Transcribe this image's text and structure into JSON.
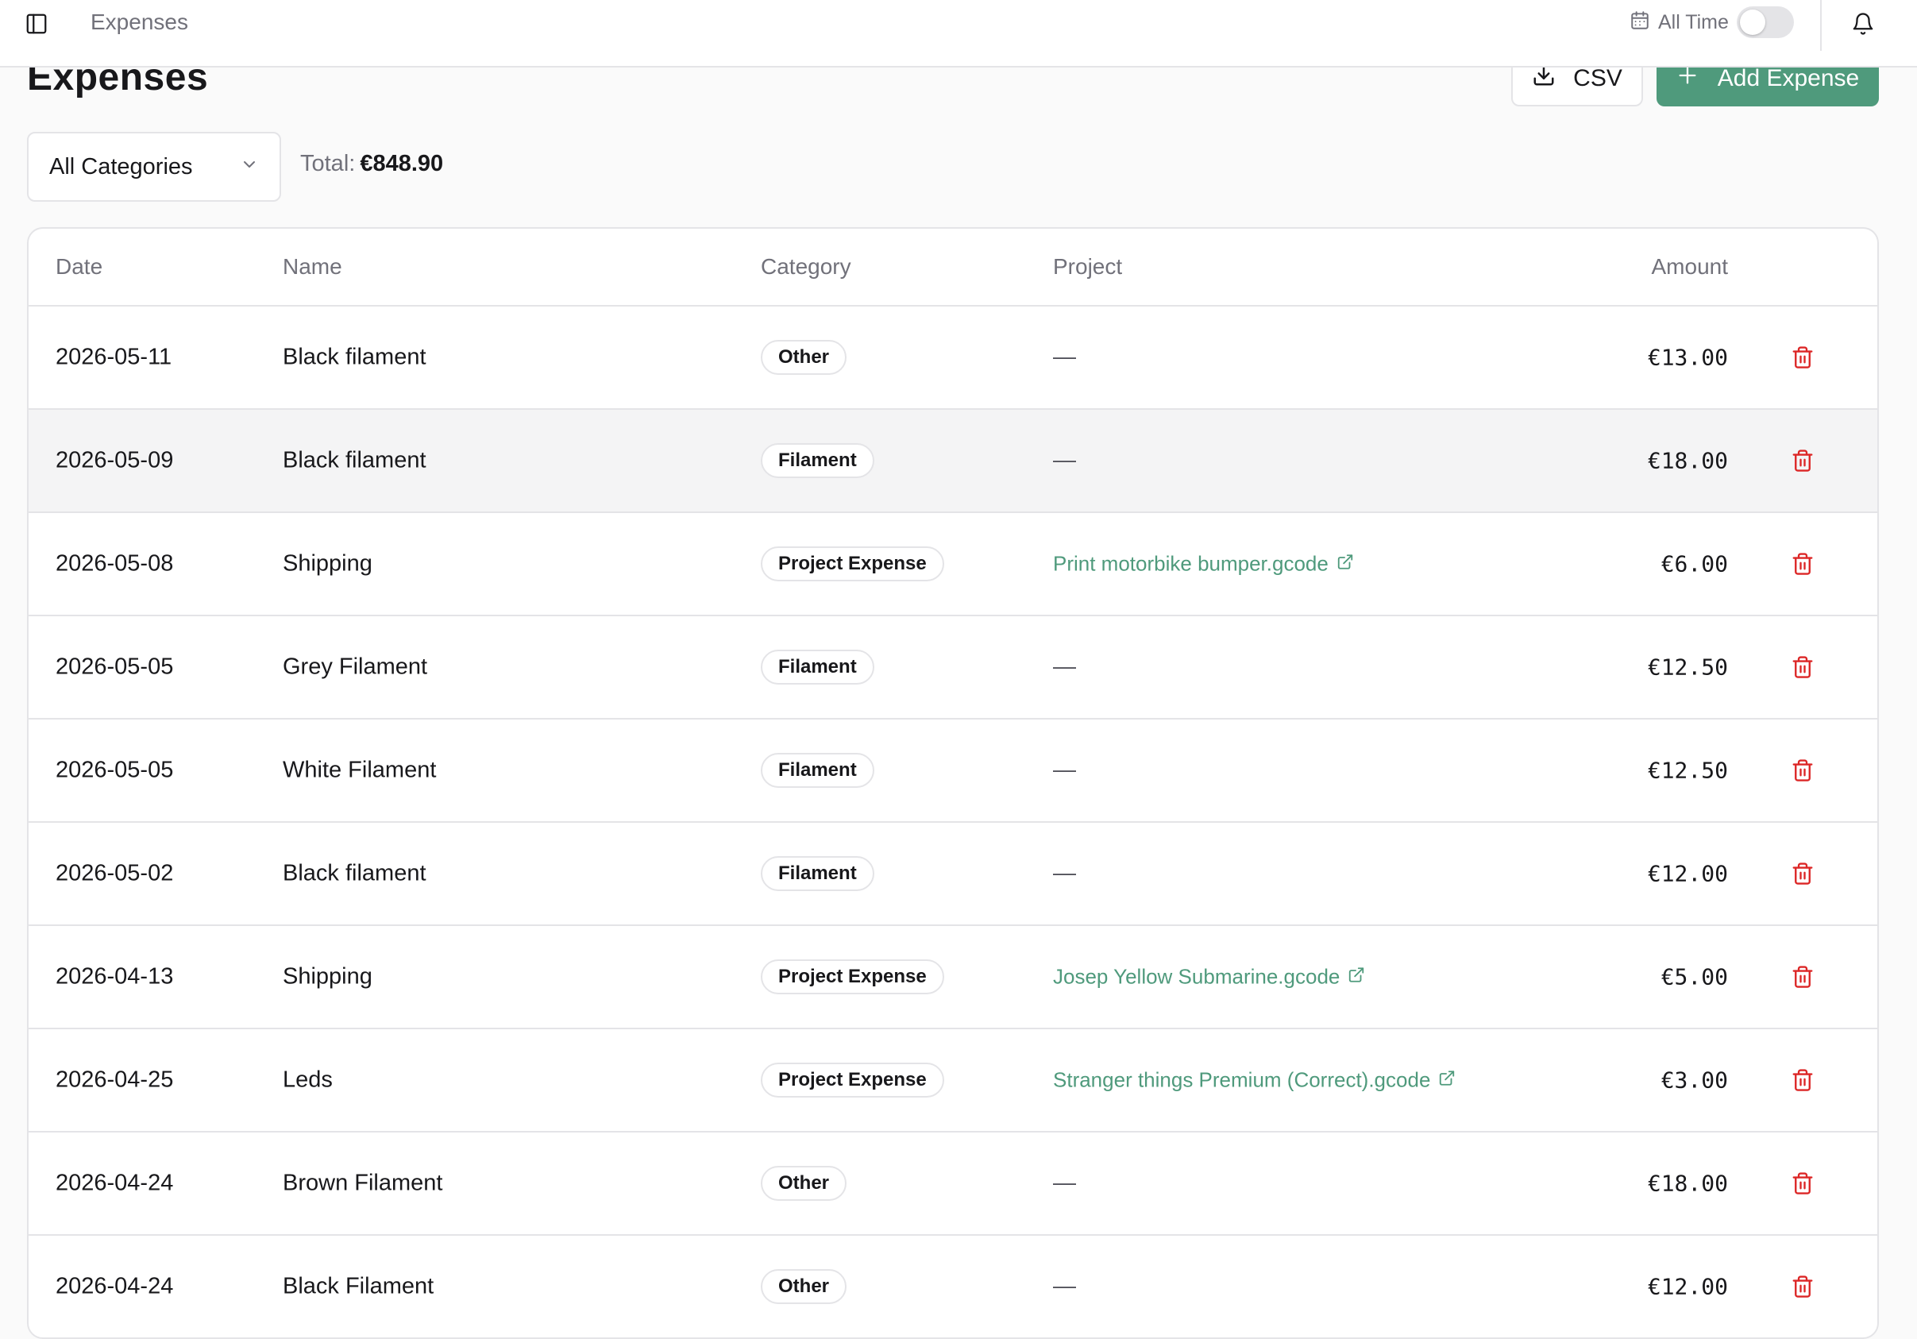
{
  "topbar": {
    "title": "Expenses",
    "range_label": "All Time"
  },
  "header": {
    "title": "Expenses",
    "csv_label": "CSV",
    "add_label": "Add Expense"
  },
  "filters": {
    "category_selected": "All Categories",
    "total_label": "Total:",
    "total_value": "€848.90"
  },
  "table": {
    "columns": [
      "Date",
      "Name",
      "Category",
      "Project",
      "Amount"
    ],
    "rows": [
      {
        "date": "2026-05-11",
        "name": "Black filament",
        "category": "Other",
        "project": "—",
        "amount": "€13.00"
      },
      {
        "date": "2026-05-09",
        "name": "Black filament",
        "category": "Filament",
        "project": "—",
        "amount": "€18.00"
      },
      {
        "date": "2026-05-08",
        "name": "Shipping",
        "category": "Project Expense",
        "project": "Print motorbike bumper.gcode",
        "amount": "€6.00"
      },
      {
        "date": "2026-05-05",
        "name": "Grey Filament",
        "category": "Filament",
        "project": "—",
        "amount": "€12.50"
      },
      {
        "date": "2026-05-05",
        "name": "White Filament",
        "category": "Filament",
        "project": "—",
        "amount": "€12.50"
      },
      {
        "date": "2026-05-02",
        "name": "Black filament",
        "category": "Filament",
        "project": "—",
        "amount": "€12.00"
      },
      {
        "date": "2026-04-13",
        "name": "Shipping",
        "category": "Project Expense",
        "project": "Josep Yellow Submarine.gcode",
        "amount": "€5.00"
      },
      {
        "date": "2026-04-25",
        "name": "Leds",
        "category": "Project Expense",
        "project": "Stranger things Premium (Correct).gcode",
        "amount": "€3.00"
      },
      {
        "date": "2026-04-24",
        "name": "Brown Filament",
        "category": "Other",
        "project": "—",
        "amount": "€18.00"
      },
      {
        "date": "2026-04-24",
        "name": "Black Filament",
        "category": "Other",
        "project": "—",
        "amount": "€12.00"
      }
    ]
  },
  "colors": {
    "accent": "#4f9a7c",
    "danger": "#dc2626",
    "muted_text": "#71717a",
    "border": "#e4e4e7"
  },
  "icons": {
    "sidebar_toggle": "sidebar-toggle-icon",
    "calendar": "calendar-icon",
    "bell": "bell-icon",
    "download": "download-icon",
    "plus": "plus-icon",
    "chevron": "chevron-down-icon",
    "external_link": "external-link-icon",
    "delete": "trash-icon"
  }
}
